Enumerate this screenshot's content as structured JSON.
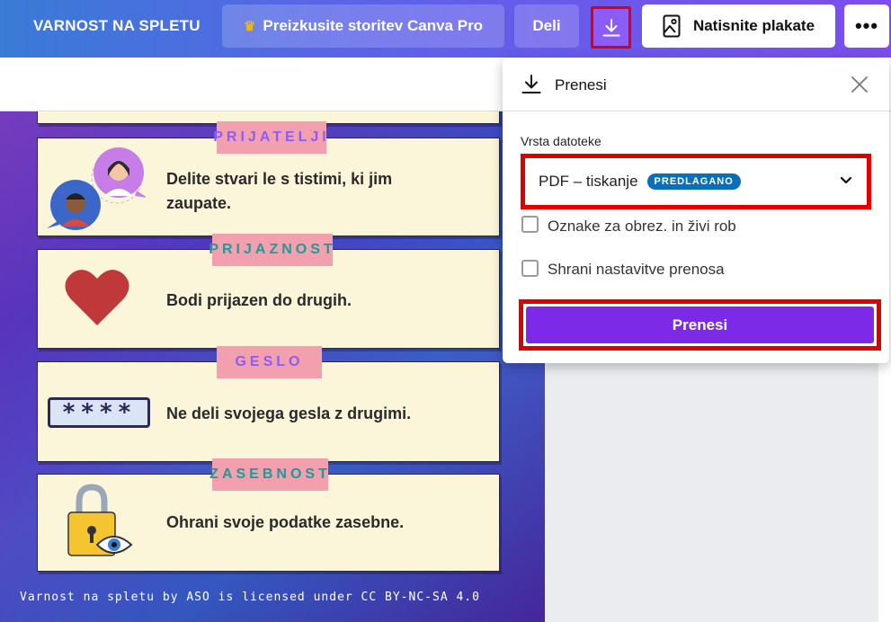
{
  "header": {
    "title": "VARNOST NA SPLETU",
    "pro_label": "Preizkusite storitev Canva Pro",
    "share_label": "Deli",
    "print_label": "Natisnite plakate",
    "more_label": "•••"
  },
  "download_panel": {
    "title": "Prenesi",
    "file_type_label": "Vrsta datoteke",
    "file_type_value": "PDF – tiskanje",
    "suggested_badge": "PREDLAGANO",
    "options": [
      {
        "label": "Oznake za obrez. in živi rob",
        "checked": false
      },
      {
        "label": "Shrani nastavitve prenosa",
        "checked": false
      }
    ],
    "download_button": "Prenesi"
  },
  "poster": {
    "cards": [
      {
        "tag": "PRIJATELJI",
        "tag_color": "#8b5cf6",
        "text": "Delite stvari le s tistimi, ki jim zaupate.",
        "icon": "friends-avatars-icon"
      },
      {
        "tag": "PRIJAZNOST",
        "tag_color": "#1f9a9a",
        "text": "Bodi prijazen do drugih.",
        "icon": "heart-icon"
      },
      {
        "tag": "GESLO",
        "tag_color": "#8b5cf6",
        "text": "Ne deli svojega gesla z drugimi.",
        "icon": "password-icon"
      },
      {
        "tag": "ZASEBNOST",
        "tag_color": "#1f9a9a",
        "text": "Ohrani svoje podatke zasebne.",
        "icon": "padlock-eye-icon"
      }
    ],
    "password_mask": "****",
    "credit": "Varnost na spletu by ASO is licensed under CC BY-NC-SA 4.0"
  },
  "colors": {
    "accent": "#7d2ae8",
    "highlight_border": "#e00000",
    "badge": "#0b6fb8",
    "card_bg": "#fbf6d9",
    "tag_bg": "#f2a0ad"
  }
}
